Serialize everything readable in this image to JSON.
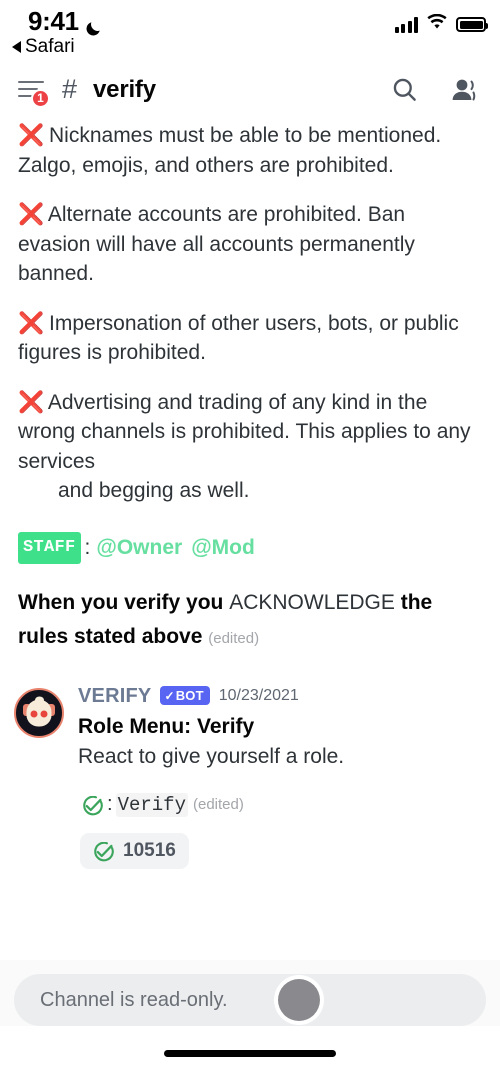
{
  "status_bar": {
    "time": "9:41",
    "dnd_icon": "crescent-moon-icon",
    "back_label": "Safari",
    "signal_icon": "cellular-signal-icon",
    "wifi_icon": "wifi-icon",
    "battery_icon": "battery-full-icon"
  },
  "header": {
    "menu_icon": "hamburger-menu-icon",
    "mention_badge": "1",
    "hash": "#",
    "channel_name": "verify",
    "search_icon": "search-icon",
    "members_icon": "members-icon"
  },
  "messages": {
    "rules": [
      {
        "mark": "❌",
        "text": "Nicknames must be able to be mentioned. Zalgo, emojis, and others are prohibited."
      },
      {
        "mark": "❌",
        "text": "Alternate accounts are prohibited. Ban evasion will have all accounts permanently banned."
      },
      {
        "mark": "❌",
        "text": "Impersonation of other users, bots, or public figures is prohibited."
      },
      {
        "mark": "❌",
        "text": "Advertising and trading of any kind in the wrong channels is prohibited. This applies to any services",
        "text2": "and begging as well."
      }
    ],
    "staff_line": {
      "badge": "STAFF",
      "separator": ":",
      "mentions": [
        "@Owner",
        "@Mod"
      ]
    },
    "acknowledge": {
      "part1": "When you verify you ",
      "emphasis": "ACKNOWLEDGE",
      "part2": " the rules stated above",
      "edited": "(edited)"
    },
    "bot_message": {
      "avatar": "verify-bot-avatar",
      "author": "VERIFY",
      "bot_badge": "BOT",
      "bot_badge_check": "✓",
      "timestamp": "10/23/2021",
      "title": "Role Menu: Verify",
      "body": "React to give yourself a role.",
      "legend": {
        "emoji": "white-check-mark-emoji",
        "separator": ":",
        "role": "Verify",
        "edited": "(edited)"
      },
      "reaction": {
        "emoji": "white-check-mark-emoji",
        "count": "10516"
      }
    }
  },
  "composer": {
    "placeholder": "Channel is read-only.",
    "touch_indicator": "touch-pointer-dot"
  }
}
